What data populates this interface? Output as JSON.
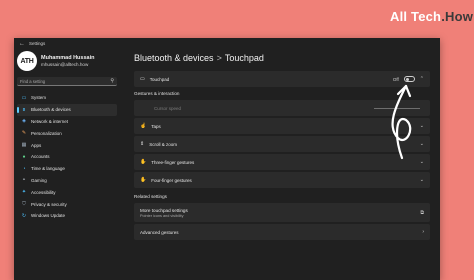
{
  "brand": {
    "part1": "All Tech",
    "part2": ".How"
  },
  "window": {
    "title": "Settings"
  },
  "profile": {
    "initials": "ATH",
    "name": "Muhammad Hussain",
    "email": "mhussain@alltech.how"
  },
  "search": {
    "placeholder": "Find a setting"
  },
  "sidebar": {
    "items": [
      {
        "label": "System",
        "icon": "monitor-icon"
      },
      {
        "label": "Bluetooth & devices",
        "icon": "bluetooth-icon",
        "active": true
      },
      {
        "label": "Network & internet",
        "icon": "wifi-icon"
      },
      {
        "label": "Personalization",
        "icon": "brush-icon"
      },
      {
        "label": "Apps",
        "icon": "apps-icon"
      },
      {
        "label": "Accounts",
        "icon": "person-icon"
      },
      {
        "label": "Time & language",
        "icon": "globe-clock-icon"
      },
      {
        "label": "Gaming",
        "icon": "gamepad-icon"
      },
      {
        "label": "Accessibility",
        "icon": "accessibility-icon"
      },
      {
        "label": "Privacy & security",
        "icon": "shield-icon"
      },
      {
        "label": "Windows Update",
        "icon": "update-icon"
      }
    ]
  },
  "breadcrumb": {
    "parent": "Bluetooth & devices",
    "separator": ">",
    "current": "Touchpad"
  },
  "touchpad": {
    "label": "Touchpad",
    "state": "Off"
  },
  "gestures": {
    "section_label": "Gestures & interaction",
    "cursor_speed_label": "Cursor speed",
    "items": [
      {
        "label": "Taps"
      },
      {
        "label": "Scroll & zoom"
      },
      {
        "label": "Three-finger gestures"
      },
      {
        "label": "Four-finger gestures"
      }
    ]
  },
  "related": {
    "section_label": "Related settings",
    "more_title": "More touchpad settings",
    "more_subtitle": "Pointer icons and visibility",
    "advanced_label": "Advanced gestures"
  },
  "colors": {
    "accent": "#60cdff",
    "background": "#f08078",
    "window": "#202020"
  }
}
